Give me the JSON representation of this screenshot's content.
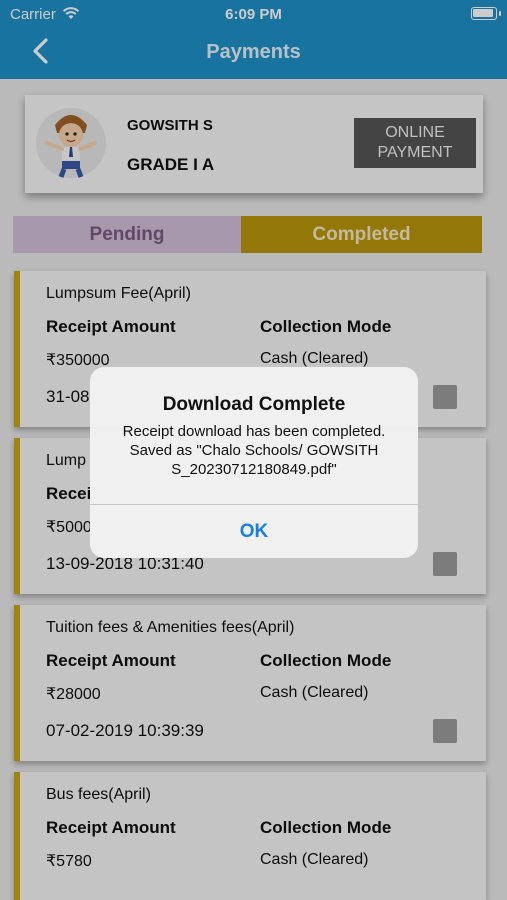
{
  "status_bar": {
    "carrier": "Carrier",
    "time": "6:09 PM"
  },
  "nav": {
    "title": "Payments",
    "back_icon": "chevron-left-icon"
  },
  "student": {
    "name": "GOWSITH S",
    "grade": "GRADE I A",
    "online_payment_label": "ONLINE PAYMENT"
  },
  "tabs": [
    {
      "label": "Pending",
      "selected": false
    },
    {
      "label": "Completed",
      "selected": true
    }
  ],
  "receipts": [
    {
      "fee_name": "Lumpsum Fee(April)",
      "amount_label": "Receipt Amount",
      "mode_label": "Collection Mode",
      "amount": "₹350000",
      "mode": "Cash (Cleared)",
      "date": "31-08"
    },
    {
      "fee_name": "Lump",
      "amount_label": "Recei",
      "mode_label": "",
      "amount": "₹5000",
      "mode": "",
      "date": "13-09-2018 10:31:40"
    },
    {
      "fee_name": "Tuition fees & Amenities fees(April)",
      "amount_label": "Receipt Amount",
      "mode_label": "Collection Mode",
      "amount": "₹28000",
      "mode": "Cash (Cleared)",
      "date": "07-02-2019 10:39:39"
    },
    {
      "fee_name": "Bus fees(April)",
      "amount_label": "Receipt Amount",
      "mode_label": "Collection Mode",
      "amount": "₹5780",
      "mode": "Cash (Cleared)",
      "date": ""
    }
  ],
  "alert": {
    "title": "Download Complete",
    "message": "Receipt download has been completed. Saved as \"Chalo Schools/ GOWSITH S_20230712180849.pdf\"",
    "ok_label": "OK"
  },
  "colors": {
    "nav_bar": "#1e90c6",
    "accent_gold": "#b8960c",
    "pending_tab": "#d2bfd6",
    "alert_button": "#1a7fe0"
  }
}
